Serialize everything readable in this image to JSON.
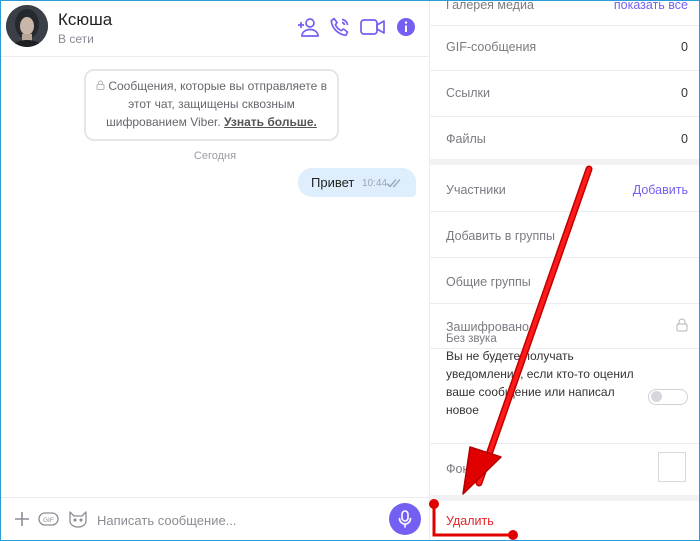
{
  "chat": {
    "contact_name": "Ксюша",
    "contact_status": "В сети",
    "encryption_notice": "Сообщения, которые вы отправляете в этот чат, защищены сквозным шифрованием Viber.",
    "encryption_link": "Узнать больше.",
    "day_label": "Сегодня",
    "messages": [
      {
        "text": "Привет",
        "time": "10:44",
        "status": "read"
      }
    ],
    "composer_placeholder": "Написать сообщение...",
    "icons": {
      "add_participant": "add-user-icon",
      "call": "phone-icon",
      "video": "video-camera-icon",
      "info": "info-icon",
      "attach": "plus-icon",
      "gif": "gif-icon",
      "sticker": "cat-sticker-icon",
      "voice": "microphone-icon"
    }
  },
  "panel": {
    "media_gallery": {
      "label": "Галерея медиа",
      "link": "показать все"
    },
    "counts": [
      {
        "label": "GIF-сообщения",
        "value": "0"
      },
      {
        "label": "Ссылки",
        "value": "0"
      },
      {
        "label": "Файлы",
        "value": "0"
      }
    ],
    "participants": {
      "label": "Участники",
      "link": "Добавить"
    },
    "add_to_groups": "Добавить в группы",
    "common_groups": "Общие группы",
    "encrypted": {
      "label": "Зашифровано",
      "icon": "lock-icon"
    },
    "mute": {
      "title": "Без звука",
      "description": "Вы не будете получать уведомления, если кто-то оценил ваше сообщение или написал новое",
      "enabled": false
    },
    "background_label": "Фон",
    "delete_label": "Удалить"
  },
  "colors": {
    "accent": "#7360f2",
    "danger": "#e2242a",
    "bubble": "#dfeefc",
    "annotation": "#e00000"
  }
}
